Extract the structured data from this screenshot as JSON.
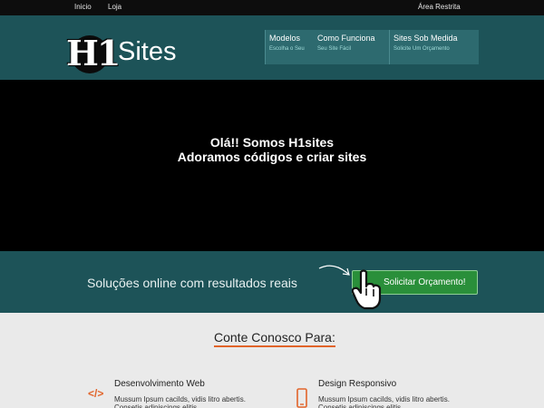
{
  "topbar": {
    "links": [
      "Inicio",
      "Loja"
    ],
    "area_restrita": "Área Restrita"
  },
  "header": {
    "logo": {
      "mark": "H1",
      "text": "Sites"
    },
    "menu": [
      {
        "title": "Modelos",
        "sub": "Escolha o Seu"
      },
      {
        "title": "Como Funciona",
        "sub": "Seu Site Fácil"
      },
      {
        "title": "Sites Sob Medida",
        "sub": "Solicite Um Orçamento"
      }
    ]
  },
  "hero": {
    "line1": "Olá!! Somos H1sites",
    "line2": "Adoramos códigos e criar sites"
  },
  "cta": {
    "text": "Soluções online com resultados reais",
    "button": "Solicitar Orçamento!"
  },
  "services": {
    "title": "Conte Conosco Para:",
    "items": [
      {
        "icon": "code-icon",
        "glyph": "</>",
        "title": "Desenvolvimento Web",
        "text": "Mussum Ipsum cacilds, vidis litro abertis. Consetis adipiscings elitis."
      },
      {
        "icon": "mobile-icon",
        "glyph": "",
        "title": "Design Responsivo",
        "text": "Mussum Ipsum cacilds, vidis litro abertis. Consetis adipiscings elitis."
      }
    ]
  },
  "colors": {
    "teal": "#1d5358",
    "accent": "#e1642a",
    "button": "#2a8f3a"
  }
}
